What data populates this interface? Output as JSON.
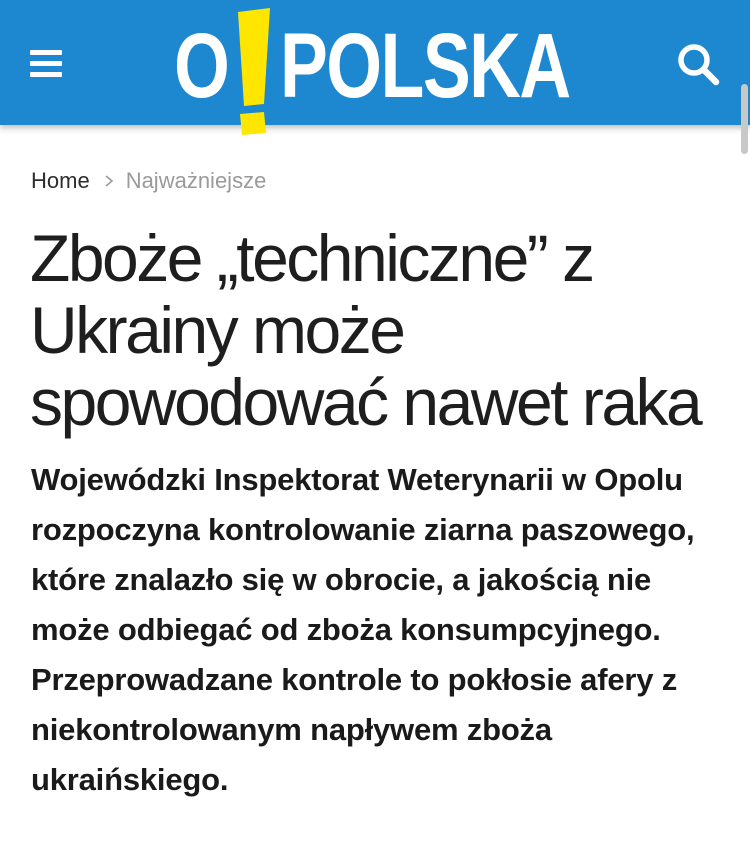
{
  "header": {
    "logo": {
      "letter": "O",
      "mark": "!",
      "word": "POLSKA"
    },
    "menu_icon": "hamburger-menu-icon",
    "search_icon": "search-icon",
    "background_color": "#1d88d0",
    "accent_color": "#ffe600"
  },
  "breadcrumb": {
    "home": "Home",
    "separator_icon": "chevron-right-icon",
    "current": "Najważniejsze"
  },
  "article": {
    "title": "Zboże „techniczne” z Ukrainy może spowodować nawet raka",
    "lead": "Wojewódzki Inspektorat Weterynarii w Opolu rozpoczyna kontrolowanie ziarna paszowego, które znalazło się w obrocie, a jakością nie może odbiegać od zboża konsumpcyjnego.  Przeprowadzane kontrole to pokłosie afery z niekontrolowanym napływem zboża ukraińskiego."
  }
}
